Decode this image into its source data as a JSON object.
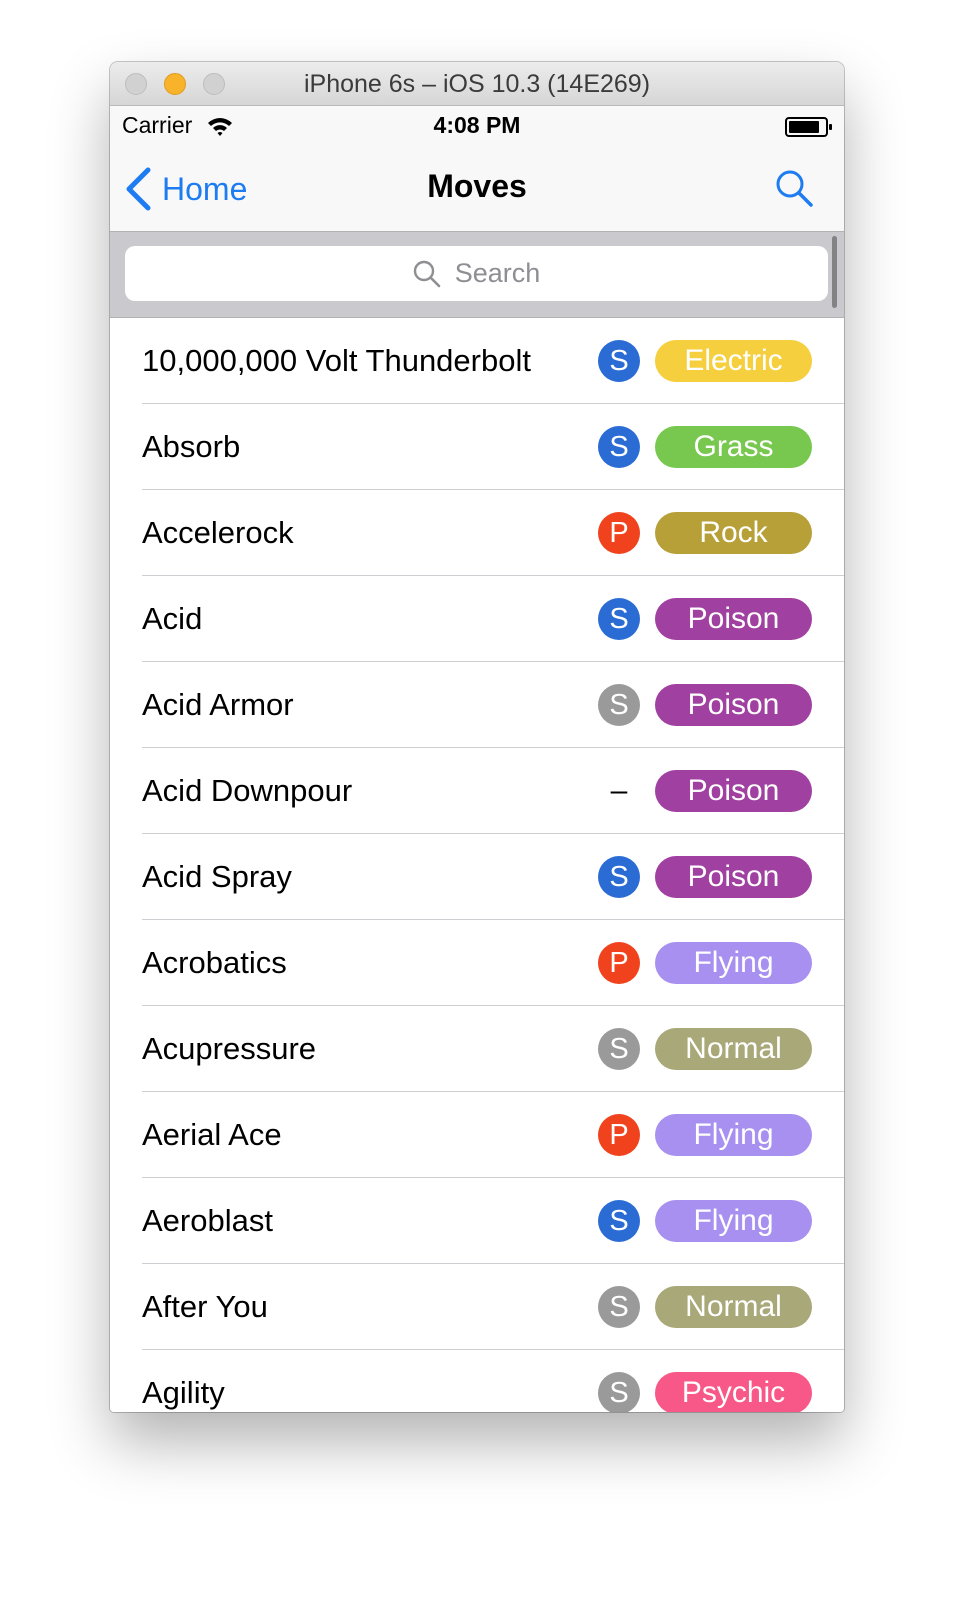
{
  "window": {
    "title": "iPhone 6s – iOS 10.3 (14E269)"
  },
  "status_bar": {
    "carrier": "Carrier",
    "time": "4:08 PM",
    "icons": [
      "wifi-icon",
      "battery-icon"
    ]
  },
  "nav": {
    "back_label": "Home",
    "title": "Moves",
    "search_icon": "search-icon"
  },
  "search": {
    "placeholder": "Search"
  },
  "colors": {
    "accent": "#1d7cf2",
    "category": {
      "S_blue": "#2b6cd4",
      "P": "#f0421c",
      "S_gray": "#9a9a9a"
    },
    "types": {
      "Electric": "#f5cf3d",
      "Grass": "#78c850",
      "Rock": "#b8a038",
      "Poison": "#a040a0",
      "Flying": "#a890f0",
      "Normal": "#a8a878",
      "Psychic": "#f85888"
    }
  },
  "moves": [
    {
      "name": "10,000,000 Volt Thunderbolt",
      "category": "S",
      "category_color": "#2b6cd4",
      "type": "Electric"
    },
    {
      "name": "Absorb",
      "category": "S",
      "category_color": "#2b6cd4",
      "type": "Grass"
    },
    {
      "name": "Accelerock",
      "category": "P",
      "category_color": "#f0421c",
      "type": "Rock"
    },
    {
      "name": "Acid",
      "category": "S",
      "category_color": "#2b6cd4",
      "type": "Poison"
    },
    {
      "name": "Acid Armor",
      "category": "S",
      "category_color": "#9a9a9a",
      "type": "Poison"
    },
    {
      "name": "Acid Downpour",
      "category": "–",
      "category_color": "",
      "type": "Poison"
    },
    {
      "name": "Acid Spray",
      "category": "S",
      "category_color": "#2b6cd4",
      "type": "Poison"
    },
    {
      "name": "Acrobatics",
      "category": "P",
      "category_color": "#f0421c",
      "type": "Flying"
    },
    {
      "name": "Acupressure",
      "category": "S",
      "category_color": "#9a9a9a",
      "type": "Normal"
    },
    {
      "name": "Aerial Ace",
      "category": "P",
      "category_color": "#f0421c",
      "type": "Flying"
    },
    {
      "name": "Aeroblast",
      "category": "S",
      "category_color": "#2b6cd4",
      "type": "Flying"
    },
    {
      "name": "After You",
      "category": "S",
      "category_color": "#9a9a9a",
      "type": "Normal"
    },
    {
      "name": "Agility",
      "category": "S",
      "category_color": "#9a9a9a",
      "type": "Psychic"
    }
  ]
}
